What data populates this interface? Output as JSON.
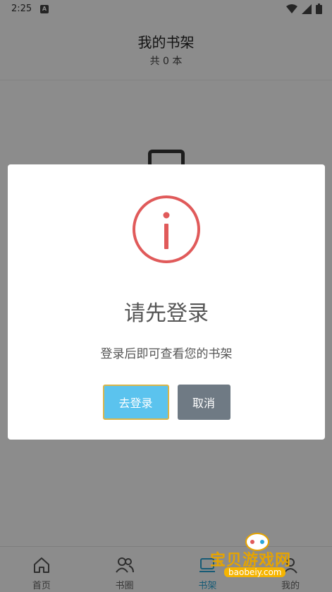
{
  "status_bar": {
    "time": "2:25",
    "badge": "A"
  },
  "header": {
    "title": "我的书架",
    "subtitle": "共 0 本"
  },
  "dialog": {
    "title": "请先登录",
    "message": "登录后即可查看您的书架",
    "confirm_label": "去登录",
    "cancel_label": "取消"
  },
  "tabs": [
    {
      "label": "首页",
      "icon": "home-icon"
    },
    {
      "label": "书圈",
      "icon": "users-icon"
    },
    {
      "label": "书架",
      "icon": "bookshelf-icon"
    },
    {
      "label": "我的",
      "icon": "profile-icon"
    }
  ],
  "watermark": {
    "text": "宝贝游戏网",
    "url": "baobeiy.com"
  },
  "colors": {
    "accent": "#2aa6d8",
    "info_red": "#e05a5a",
    "login_button": "#5bc3ee",
    "cancel_button": "#6f7a84"
  }
}
